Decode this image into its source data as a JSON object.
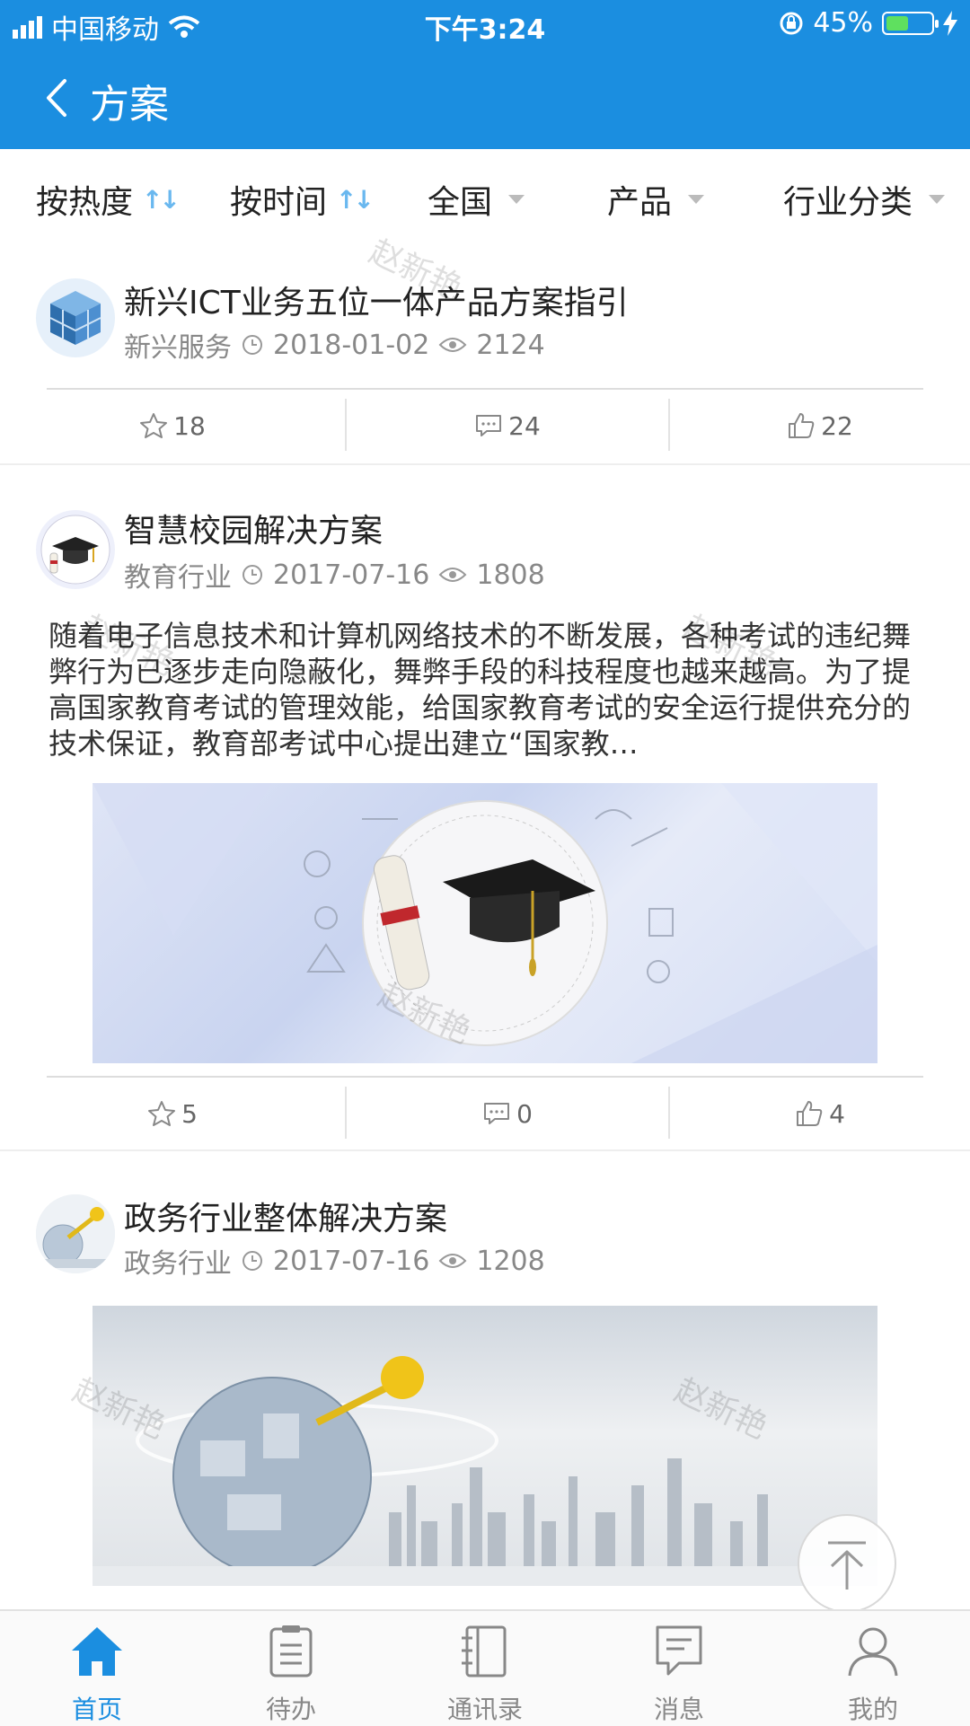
{
  "status_bar": {
    "carrier": "中国移动",
    "time": "下午3:24",
    "battery": "45%",
    "battery_level": 0.45
  },
  "nav": {
    "title": "方案"
  },
  "filters": [
    {
      "label": "按热度",
      "type": "sort"
    },
    {
      "label": "按时间",
      "type": "sort"
    },
    {
      "label": "全国",
      "type": "dropdown"
    },
    {
      "label": "产品",
      "type": "dropdown"
    },
    {
      "label": "行业分类",
      "type": "dropdown"
    }
  ],
  "cards": [
    {
      "title": "新兴ICT业务五位一体产品方案指引",
      "category": "新兴服务",
      "date": "2018-01-02",
      "views": "2124",
      "favorites": "18",
      "comments": "24",
      "likes": "22",
      "avatar_icon": "cube-icon"
    },
    {
      "title": "智慧校园解决方案",
      "category": "教育行业",
      "date": "2017-07-16",
      "views": "1808",
      "summary": "随着电子信息技术和计算机网络技术的不断发展，各种考试的违纪舞弊行为已逐步走向隐蔽化，舞弊手段的科技程度也越来越高。为了提高国家教育考试的管理效能，给国家教育考试的安全运行提供充分的技术保证，教育部考试中心提出建立“国家教…",
      "favorites": "5",
      "comments": "0",
      "likes": "4",
      "avatar_icon": "graduation-cap-icon"
    },
    {
      "title": "政务行业整体解决方案",
      "category": "政务行业",
      "date": "2017-07-16",
      "views": "1208",
      "avatar_icon": "key-globe-icon"
    }
  ],
  "watermark": "赵新艳",
  "tabbar": [
    {
      "label": "首页",
      "icon": "home-icon",
      "active": true
    },
    {
      "label": "待办",
      "icon": "clipboard-icon",
      "active": false
    },
    {
      "label": "通讯录",
      "icon": "contacts-book-icon",
      "active": false
    },
    {
      "label": "消息",
      "icon": "message-icon",
      "active": false
    },
    {
      "label": "我的",
      "icon": "person-icon",
      "active": false
    }
  ],
  "colors": {
    "primary": "#1b8ee0",
    "sort_icon": "#6ab8ef",
    "text": "#222222",
    "meta": "#888888"
  }
}
